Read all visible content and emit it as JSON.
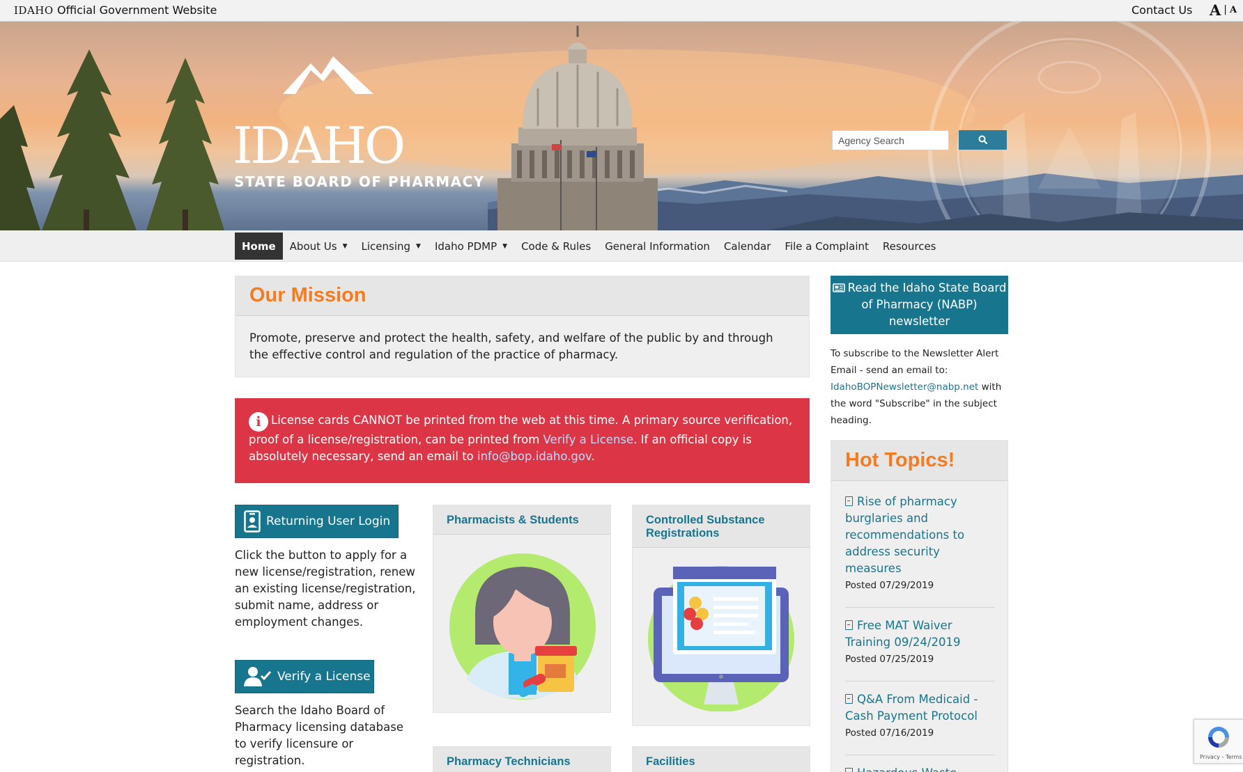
{
  "topbar": {
    "mini_logo": "IDAHO",
    "official": "Official Government Website",
    "contact": "Contact Us",
    "font_large": "A",
    "font_sep": "|",
    "font_small": "A"
  },
  "header": {
    "wordmark": "IDAHO",
    "subtitle": "STATE BOARD OF PHARMACY",
    "search_placeholder": "Agency Search"
  },
  "nav": {
    "items": [
      "Home",
      "About Us",
      "Licensing",
      "Idaho PDMP",
      "Code & Rules",
      "General Information",
      "Calendar",
      "File a Complaint",
      "Resources"
    ]
  },
  "mission": {
    "title": "Our Mission",
    "body": "Promote, preserve and protect the health, safety, and welfare of the public by and through the effective control and regulation of the practice of pharmacy."
  },
  "alert": {
    "text_1": "License cards CANNOT be printed from the web at this time. A primary source verification, proof of a license/registration, can be printed from ",
    "link_1": "Verify a License",
    "text_2": ". If an official copy is absolutely necessary, send an email to ",
    "link_2": "info@bop.idaho.gov",
    "text_3": "."
  },
  "login": {
    "button": "Returning User Login",
    "description": "Click the button to apply for a new license/registration, renew an existing license/registration, submit name, address or employment changes."
  },
  "verify": {
    "button": "Verify a License",
    "description": "Search the Idaho Board of Pharmacy licensing database to verify licensure or registration."
  },
  "categories": {
    "pharmacists": "Pharmacists & Students",
    "controlled": "Controlled Substance Registrations",
    "technicians": "Pharmacy Technicians",
    "facilities": "Facilities"
  },
  "newsletter": {
    "button": "Read the Idaho State Board of Pharmacy (NABP) newsletter",
    "text_1": "To subscribe to the Newsletter Alert Email - send an email to: ",
    "email": "IdahoBOPNewsletter@nabp.net",
    "text_2": " with the word \"Subscribe\" in the subject heading."
  },
  "hot_topics": {
    "title": "Hot Topics!",
    "items": [
      {
        "title": "Rise of pharmacy burglaries and recommendations to address security measures",
        "date": "Posted 07/29/2019"
      },
      {
        "title": "Free MAT Waiver Training 09/24/2019",
        "date": "Posted 07/25/2019"
      },
      {
        "title": "Q&A From Medicaid - Cash Payment Protocol",
        "date": "Posted 07/16/2019"
      },
      {
        "title": "Hazardous Waste",
        "date": ""
      }
    ]
  },
  "recaptcha": {
    "text": "Privacy - Terms"
  },
  "colors": {
    "teal": "#17758e",
    "orange": "#f47b20",
    "alert_red": "#dc3545",
    "nav_active": "#333333"
  }
}
